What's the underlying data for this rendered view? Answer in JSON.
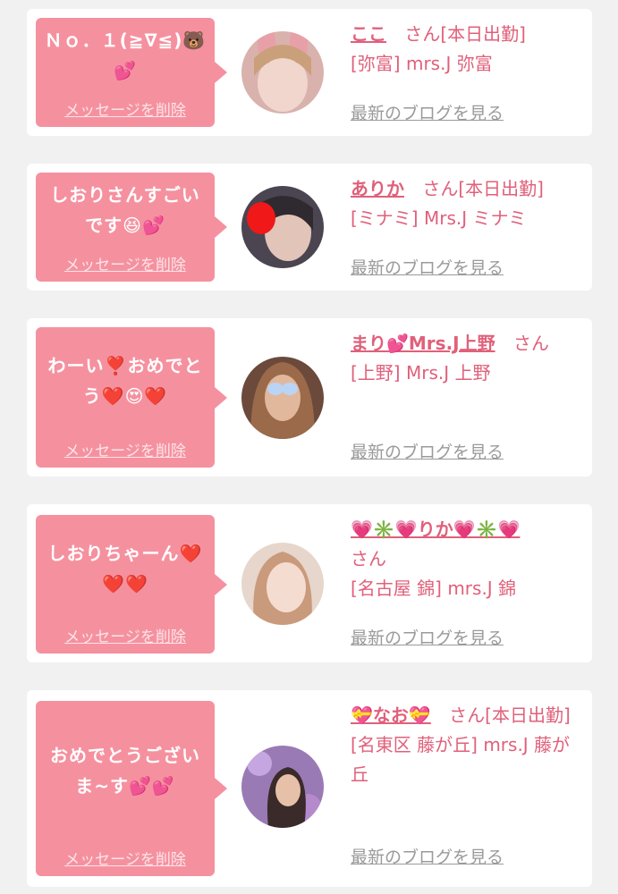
{
  "messages": [
    {
      "message": "Ｎｏ．１(≧∇≦)🐻💕",
      "delete_label": "メッセージを削除",
      "name": "ここ",
      "suffix": "さん[本日出勤]",
      "shop": "[弥富] mrs.J 弥富",
      "blog_label": "最新のブログを見る",
      "avatar_color": "#e8c6c0"
    },
    {
      "message": "しおりさんすごいです😆💕",
      "delete_label": "メッセージを削除",
      "name": "ありか",
      "suffix": "さん[本日出勤]",
      "shop": "[ミナミ] Mrs.J ミナミ",
      "blog_label": "最新のブログを見る",
      "avatar_color": "#6a6270"
    },
    {
      "message": "わーい❣️おめでとう❤️😍❤️",
      "delete_label": "メッセージを削除",
      "name": "まり💕Mrs.J上野",
      "suffix": "さん",
      "shop": "[上野] Mrs.J 上野",
      "blog_label": "最新のブログを見る",
      "avatar_color": "#7a5a4a"
    },
    {
      "message": "しおりちゃーん❤️❤️❤️",
      "delete_label": "メッセージを削除",
      "name": "💗✳️💗りか💗✳️💗",
      "suffix": "さん",
      "shop": "[名古屋 錦] mrs.J 錦",
      "blog_label": "最新のブログを見る",
      "avatar_color": "#e9d2c8"
    },
    {
      "message": "おめでとうございま~す💕💕",
      "delete_label": "メッセージを削除",
      "name": "💝なお💝",
      "suffix": "さん[本日出勤]",
      "shop": "[名東区 藤が丘] mrs.J 藤が丘",
      "blog_label": "最新のブログを見る",
      "avatar_color": "#8a6aa0"
    }
  ]
}
